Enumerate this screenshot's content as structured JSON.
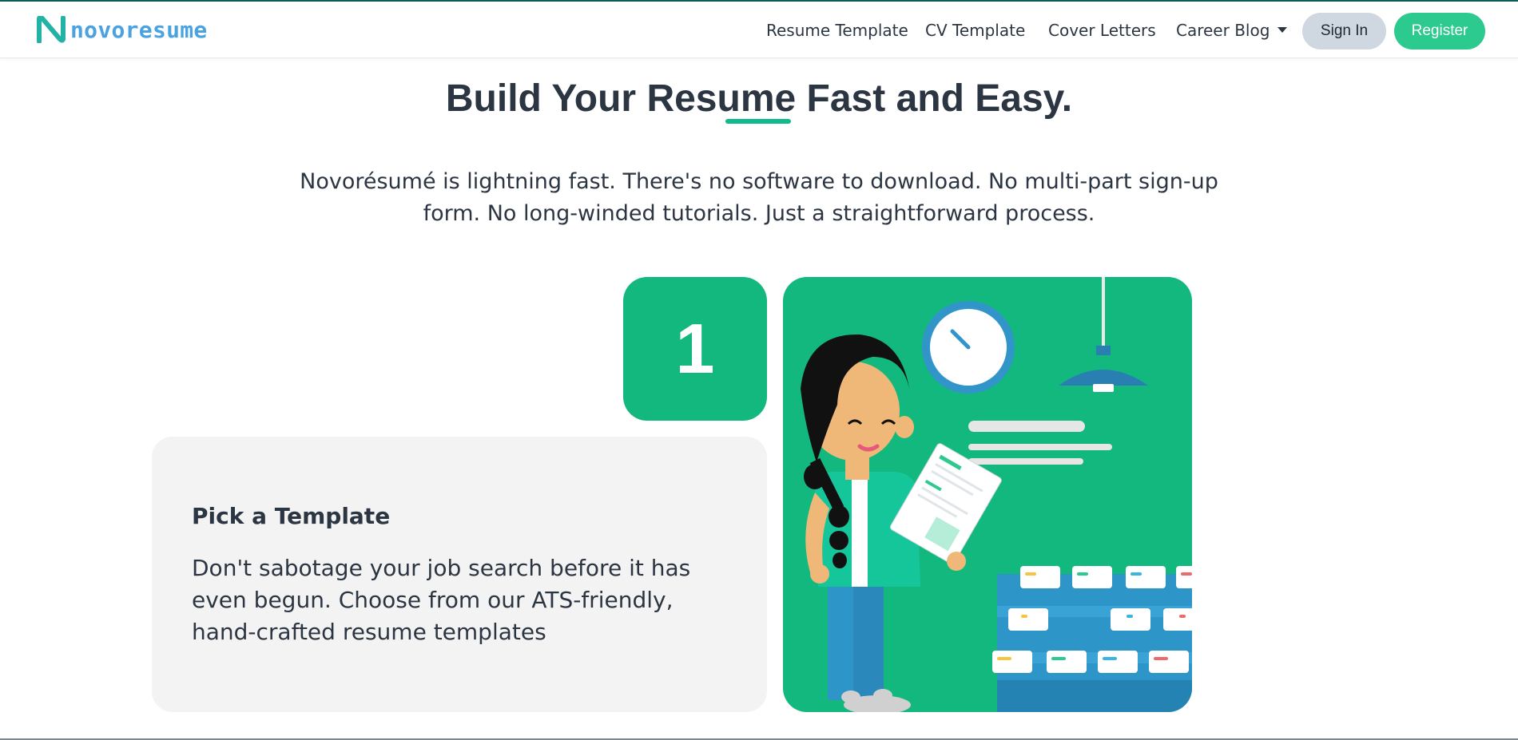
{
  "header": {
    "logo_text": "novoresume",
    "nav": [
      "Resume Template",
      "CV Template",
      "Cover Letters",
      "Career Blog"
    ],
    "signin_label": "Sign In",
    "register_label": "Register"
  },
  "hero": {
    "title": "Build Your Resume Fast and Easy.",
    "subtitle": "Novorésumé is lightning fast. There's no software to download. No multi-part sign-up form. No long-winded tutorials. Just a straightforward process."
  },
  "step": {
    "number": "1",
    "title": "Pick a Template",
    "description": "Don't sabotage your job search before it has even begun. Choose from our ATS-friendly, hand-crafted resume templates"
  },
  "colors": {
    "brand_green": "#13b87e",
    "register_green": "#2cca8f",
    "logo_blue": "#4aa3e0",
    "text_dark": "#2c3542"
  },
  "icons": [
    "novoresume-logo-icon",
    "caret-down-icon"
  ]
}
